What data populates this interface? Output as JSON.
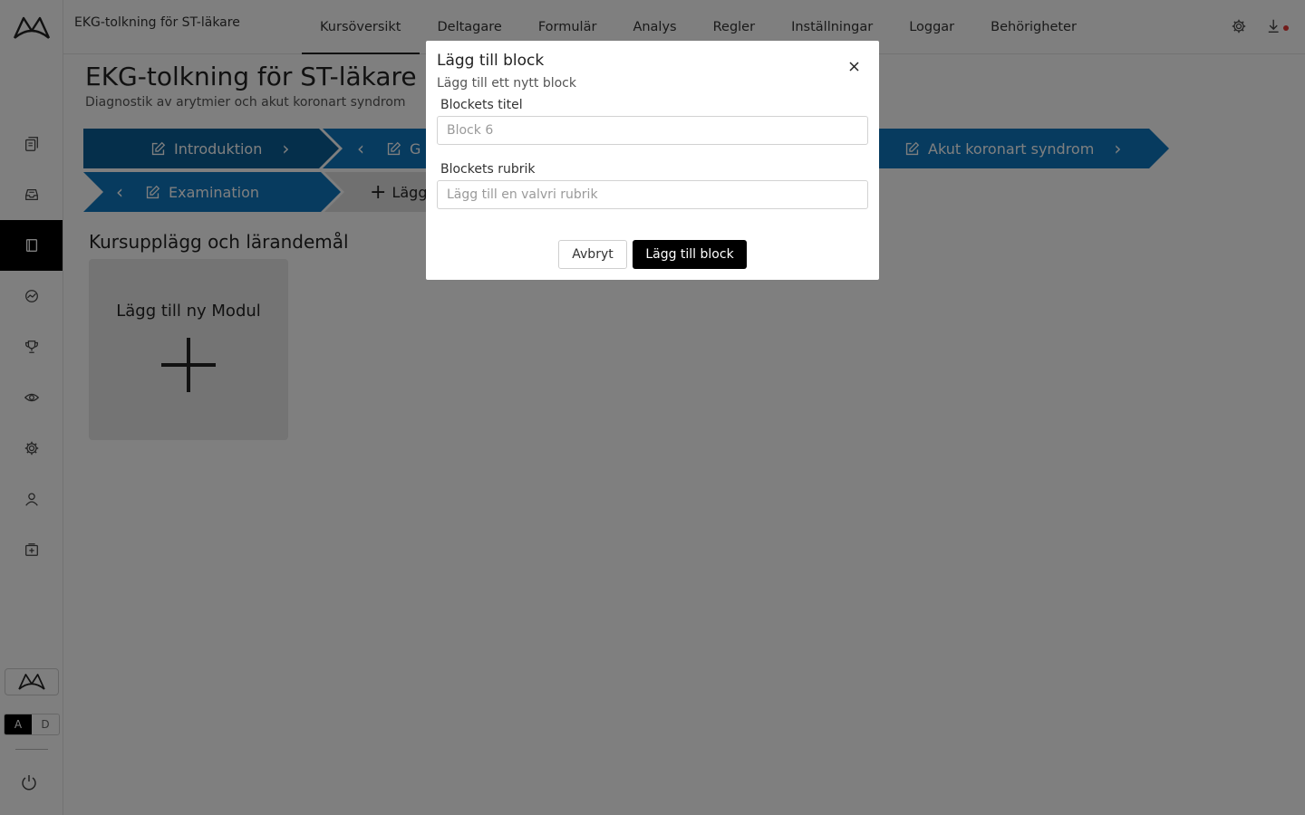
{
  "topbar": {
    "course_name": "EKG-tolkning för ST-läkare",
    "tabs": [
      {
        "label": "Kursöversikt",
        "active": true
      },
      {
        "label": "Deltagare",
        "active": false
      },
      {
        "label": "Formulär",
        "active": false
      },
      {
        "label": "Analys",
        "active": false
      },
      {
        "label": "Regler",
        "active": false
      },
      {
        "label": "Inställningar",
        "active": false
      },
      {
        "label": "Loggar",
        "active": false
      },
      {
        "label": "Behörigheter",
        "active": false
      }
    ],
    "icons": [
      "gear-icon",
      "download-icon"
    ],
    "notification_color": "#e53935"
  },
  "sidebar": {
    "items": [
      {
        "icon": "documents-icon",
        "active": false
      },
      {
        "icon": "inbox-icon",
        "active": false
      },
      {
        "icon": "notebook-icon",
        "active": true
      },
      {
        "icon": "analytics-icon",
        "active": false
      },
      {
        "icon": "trophy-icon",
        "active": false
      },
      {
        "icon": "eye-icon",
        "active": false
      },
      {
        "icon": "gear-icon",
        "active": false
      },
      {
        "icon": "user-icon",
        "active": false
      },
      {
        "icon": "add-box-icon",
        "active": false
      }
    ],
    "lang_toggle": {
      "a": "A",
      "d": "D",
      "selected": "A"
    }
  },
  "page": {
    "title": "EKG-tolkning för ST-läkare",
    "subtitle": "Diagnostik av arytmier och akut koronart syndrom"
  },
  "steps": [
    {
      "label": "Introduktion"
    },
    {
      "label": "G"
    },
    {
      "label": "Akut koronart syndrom"
    },
    {
      "label": "Examination"
    },
    {
      "label": "Lägg"
    }
  ],
  "colors": {
    "step_dark": "#0b5f97",
    "step_light": "#0e77bf",
    "step_add": "#e0e0e0",
    "primary_button": "#000000"
  },
  "section": {
    "title": "Kursupplägg och lärandemål",
    "add_module_label": "Lägg till ny Modul"
  },
  "modal": {
    "title": "Lägg till block",
    "subtitle": "Lägg till ett nytt block",
    "title_field": {
      "label": "Blockets titel",
      "placeholder": "Block 6",
      "value": ""
    },
    "heading_field": {
      "label": "Blockets rubrik",
      "placeholder": "Lägg till en valvri rubrik",
      "value": ""
    },
    "cancel_label": "Avbryt",
    "submit_label": "Lägg till block"
  }
}
